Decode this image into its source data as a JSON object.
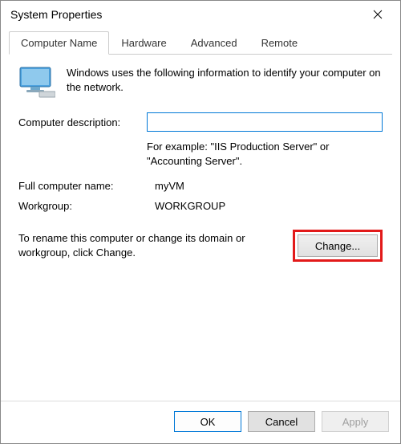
{
  "window": {
    "title": "System Properties"
  },
  "tabs": {
    "computer_name": "Computer Name",
    "hardware": "Hardware",
    "advanced": "Advanced",
    "remote": "Remote"
  },
  "intro": "Windows uses the following information to identify your computer on the network.",
  "desc": {
    "label": "Computer description:",
    "value": "",
    "hint": "For example: \"IIS Production Server\" or \"Accounting Server\"."
  },
  "full_name": {
    "label": "Full computer name:",
    "value": "myVM"
  },
  "workgroup": {
    "label": "Workgroup:",
    "value": "WORKGROUP"
  },
  "change": {
    "text": "To rename this computer or change its domain or workgroup, click Change.",
    "button": "Change..."
  },
  "footer": {
    "ok": "OK",
    "cancel": "Cancel",
    "apply": "Apply"
  }
}
